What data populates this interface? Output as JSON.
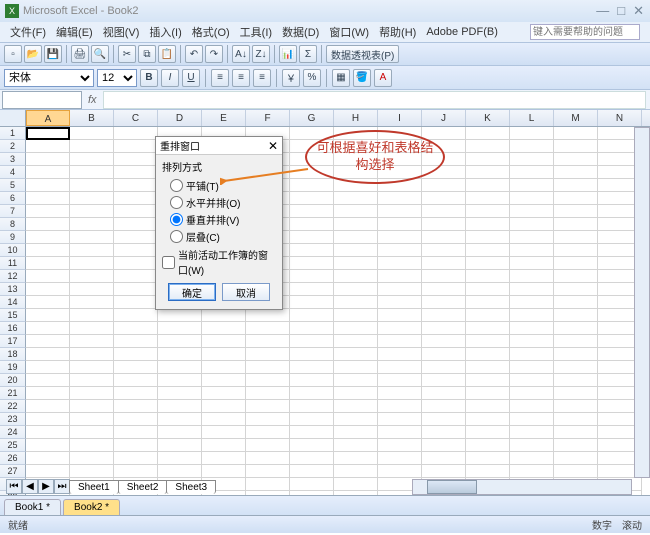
{
  "app": {
    "title": "Microsoft Excel - Book2"
  },
  "window_controls": {
    "min": "—",
    "max": "□",
    "close": "✕"
  },
  "menus": [
    "文件(F)",
    "编辑(E)",
    "视图(V)",
    "插入(I)",
    "格式(O)",
    "工具(I)",
    "数据(D)",
    "窗口(W)",
    "帮助(H)",
    "Adobe PDF(B)"
  ],
  "help_placeholder": "键入需要帮助的问题",
  "font": {
    "name": "宋体",
    "size": "12"
  },
  "namebox": "",
  "columns": [
    "A",
    "B",
    "C",
    "D",
    "E",
    "F",
    "G",
    "H",
    "I",
    "J",
    "K",
    "L",
    "M",
    "N"
  ],
  "selected_col": "A",
  "row_count": 29,
  "selected_cell": {
    "r": 1,
    "c": 0
  },
  "sheet_nav": [
    "⏮",
    "◀",
    "▶",
    "⏭"
  ],
  "sheets": [
    "Sheet1",
    "Sheet2",
    "Sheet3"
  ],
  "workbook_tabs": [
    {
      "label": "Book1 *",
      "active": false
    },
    {
      "label": "Book2 *",
      "active": true
    }
  ],
  "status": {
    "left": "就绪",
    "right": [
      "数字",
      "滚动"
    ]
  },
  "dialog": {
    "title": "重排窗口",
    "group_label": "排列方式",
    "options": [
      {
        "label": "平铺(T)"
      },
      {
        "label": "水平并排(O)"
      },
      {
        "label": "垂直并排(V)"
      },
      {
        "label": "层叠(C)"
      }
    ],
    "selected_index": 2,
    "checkbox": "当前活动工作簿的窗口(W)",
    "ok": "确定",
    "cancel": "取消"
  },
  "annotation": {
    "text": "可根据喜好和表格结构选择"
  },
  "toolbar2_label": "数据透视表(P)"
}
